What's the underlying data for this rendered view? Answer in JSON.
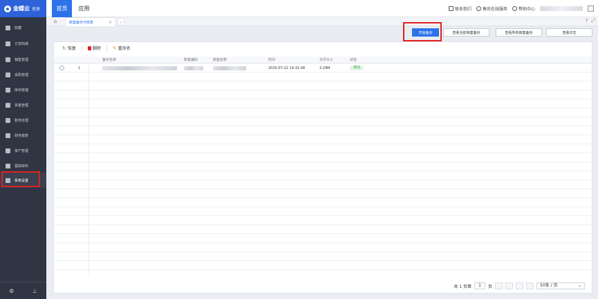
{
  "topbar": {
    "logo": "金蝶云",
    "logo_sub": "星辰",
    "nav": [
      "首页",
      "应用"
    ],
    "right_items": [
      "联系我们",
      "售后在线服务",
      "帮助中心"
    ]
  },
  "sidebar": {
    "items": [
      {
        "label": "收藏",
        "icon": "star-icon"
      },
      {
        "label": "订货商城",
        "icon": "cart-icon"
      },
      {
        "label": "销售管理",
        "icon": "chart-icon"
      },
      {
        "label": "采购管理",
        "icon": "cart-icon"
      },
      {
        "label": "库存管理",
        "icon": "box-icon"
      },
      {
        "label": "资金管理",
        "icon": "wallet-icon"
      },
      {
        "label": "账务处理",
        "icon": "ledger-icon"
      },
      {
        "label": "财务报表",
        "icon": "report-icon"
      },
      {
        "label": "资产管理",
        "icon": "asset-icon"
      },
      {
        "label": "基础资料",
        "icon": "database-icon"
      },
      {
        "label": "系统设置",
        "icon": "gear-icon",
        "active": true
      }
    ]
  },
  "tabs": {
    "active_label": "账套备份与恢复"
  },
  "actions": {
    "start_backup": "开始备份",
    "view_current": "查看当前账套备份",
    "view_all": "查看所有账套备份",
    "view_log": "查看日志"
  },
  "toolbar": {
    "restore": "恢复",
    "delete": "删除",
    "rename": "重命名"
  },
  "grid": {
    "headers": [
      "备份名称",
      "账套编码",
      "账套名称",
      "时间",
      "文件大小",
      "状态"
    ],
    "rows": [
      {
        "index": "1",
        "time": "2020-07-22 14:31:08",
        "size": "3.29M",
        "status": "成功"
      }
    ]
  },
  "pager": {
    "total": "共 1 页第",
    "page": "1",
    "page_suffix": "页",
    "page_size": "50条 / 页"
  },
  "colors": {
    "brand": "#2d62d8",
    "accent": "#2d72e8",
    "highlight": "#e0201f",
    "success": "#2fa335"
  }
}
